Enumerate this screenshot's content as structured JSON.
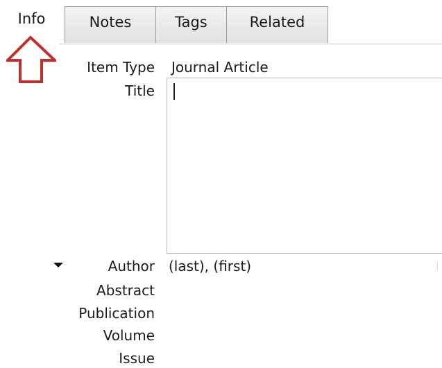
{
  "tabs": [
    {
      "label": "Info",
      "active": true
    },
    {
      "label": "Notes",
      "active": false
    },
    {
      "label": "Tags",
      "active": false
    },
    {
      "label": "Related",
      "active": false
    }
  ],
  "annotation": {
    "icon": "up-arrow-icon",
    "color": "#c0302b"
  },
  "fields": {
    "item_type": {
      "label": "Item Type",
      "value": "Journal Article"
    },
    "title": {
      "label": "Title",
      "value": ""
    },
    "author": {
      "label": "Author",
      "value": "(last), (first)",
      "toggle_icon": "triangle-down-icon"
    },
    "abstract": {
      "label": "Abstract"
    },
    "publication": {
      "label": "Publication"
    },
    "volume": {
      "label": "Volume"
    },
    "issue": {
      "label": "Issue"
    }
  }
}
